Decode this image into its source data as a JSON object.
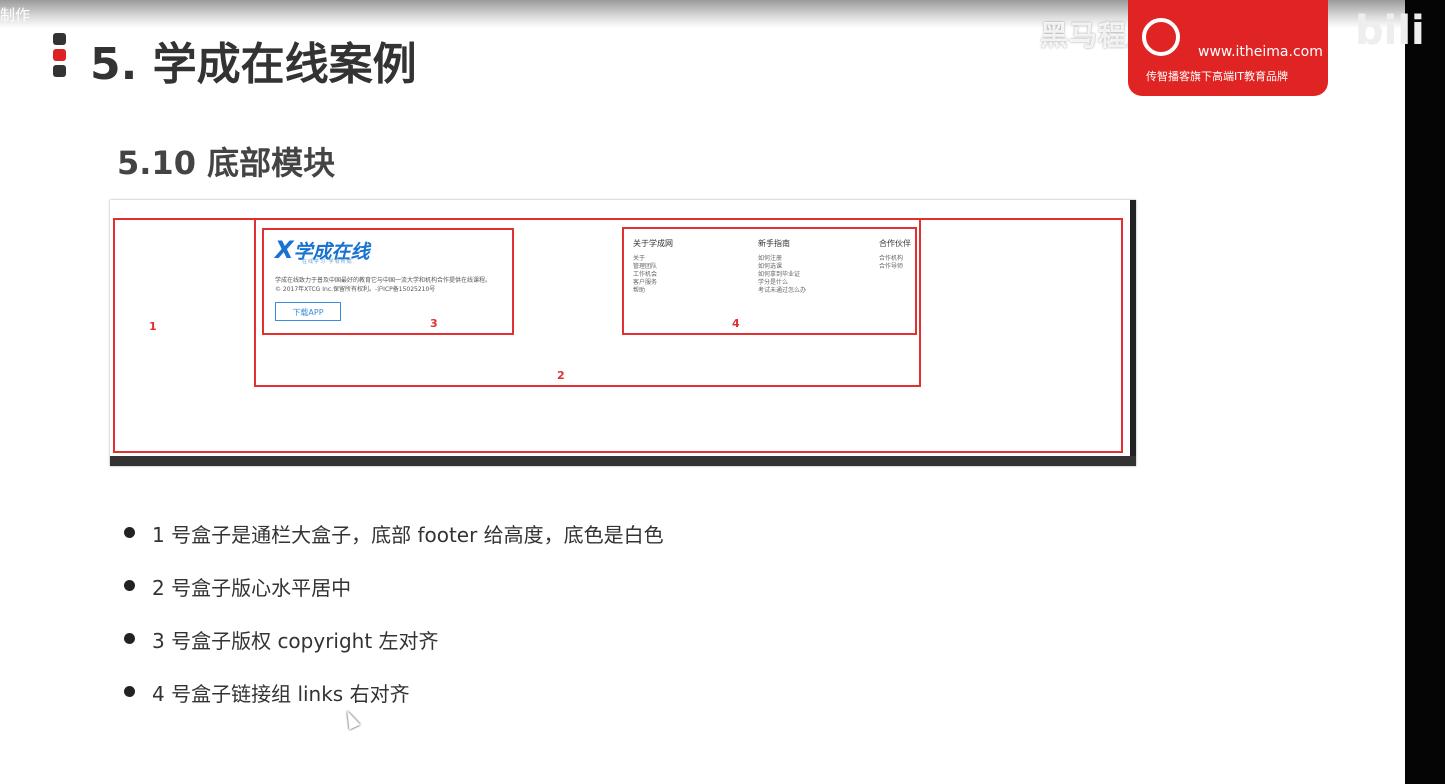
{
  "corner_label": "制作",
  "watermark": "黑马程序员pink老师",
  "bili_mark": "bili",
  "brand": {
    "site": "www.itheima.com",
    "slogan": "传智播客旗下高端IT教育品牌",
    "color": "#e02424"
  },
  "slide": {
    "title": "5. 学成在线案例",
    "subtitle": "5.10 底部模块"
  },
  "mockup": {
    "box_numbers": [
      "1",
      "2",
      "3",
      "4"
    ],
    "logo_text": "学成在线",
    "logo_tag": "在线学习·学有所成",
    "copyright_lines": [
      "学成在线致力于普及中国最好的教育它与中国一流大学和机构合作提供在线课程。",
      "© 2017年XTCG Inc.保留所有权利。-沪ICP备15025210号"
    ],
    "download_button": "下载APP",
    "link_groups": [
      {
        "heading": "关于学成网",
        "items": [
          "关于",
          "管理团队",
          "工作机会",
          "客户服务",
          "帮助"
        ]
      },
      {
        "heading": "新手指南",
        "items": [
          "如何注册",
          "如何选课",
          "如何拿到毕业证",
          "学分是什么",
          "考试未通过怎么办"
        ]
      },
      {
        "heading": "合作伙伴",
        "items": [
          "合作机构",
          "合作导师"
        ]
      }
    ],
    "accent_color": "#e03030"
  },
  "bullets": [
    "1 号盒子是通栏大盒子，底部 footer 给高度，底色是白色",
    "2 号盒子版心水平居中",
    "3 号盒子版权 copyright  左对齐",
    "4 号盒子链接组 links  右对齐"
  ]
}
